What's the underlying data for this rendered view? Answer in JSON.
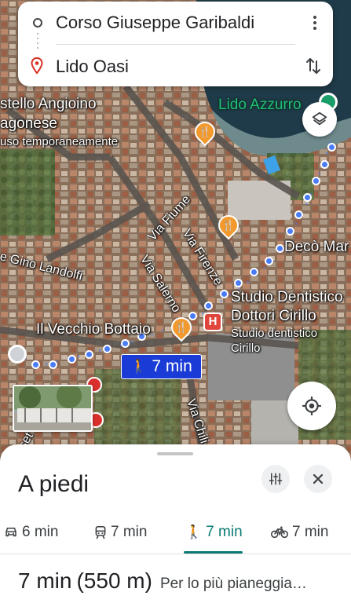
{
  "search": {
    "origin": "Corso Giuseppe Garibaldi",
    "destination": "Lido Oasi",
    "menu_icon": "more-vert-icon",
    "swap_icon": "swap-vert-icon"
  },
  "map": {
    "labels": {
      "castello_line1": "stello Angioino",
      "castello_line2": "agonese",
      "castello_line3": "uso temporaneamente",
      "lido_azzurro": "Lido Azzurro",
      "via_fiume": "Via Fiume",
      "via_firenze": "Via Firenze",
      "via_salerno": "Via Salerno",
      "gino_landolfi": "e Gino Landolfi",
      "deco_mar": "Decò Mar",
      "studio_line1": "Studio Dentistico",
      "studio_line2": "Dottori Cirillo",
      "studio_sub1": "Studio dentistico",
      "studio_sub2": "Cirillo",
      "vecchio_bottaio": "Il Vecchio Bottaio",
      "via_chili": "Via Chili",
      "lower_left": "set"
    },
    "route_time": "7 min",
    "colors": {
      "route": "#4a7cf7",
      "chip": "#1a3bd6",
      "poi": "#f29a2e",
      "hospital": "#e0463c",
      "accent_green": "#21c07a"
    }
  },
  "sheet": {
    "title": "A piedi",
    "modes": [
      {
        "name": "car",
        "icon": "car-icon",
        "label": "6 min"
      },
      {
        "name": "transit",
        "icon": "train-icon",
        "label": "7 min"
      },
      {
        "name": "walk",
        "icon": "walk-icon",
        "label": "7 min",
        "active": true
      },
      {
        "name": "bike",
        "icon": "bike-icon",
        "label": "7 min"
      }
    ],
    "summary_time": "7 min",
    "summary_distance": "(550 m)",
    "summary_desc": "Per lo più pianeggiante"
  }
}
